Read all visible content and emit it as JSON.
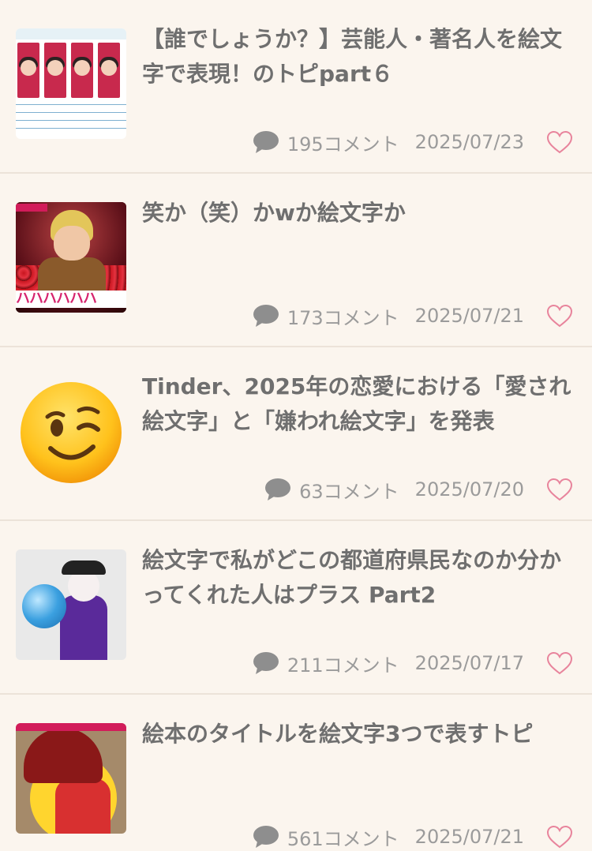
{
  "topics": [
    {
      "title": "【誰でしょうか？】芸能人・著名人を絵文字で表現！のトピpart６",
      "comments": "195コメント",
      "date": "2025/07/23",
      "thumb": "celebrity-table"
    },
    {
      "title": "笑か（笑）かwか絵文字か",
      "comments": "173コメント",
      "date": "2025/07/21",
      "thumb": "laughing-man",
      "thumb_text": "ハハハハハハ"
    },
    {
      "title": "Tinder、2025年の恋愛における「愛され絵文字」と「嫌われ絵文字」を発表",
      "comments": "63コメント",
      "date": "2025/07/20",
      "thumb": "winking-face-emoji"
    },
    {
      "title": "絵文字で私がどこの都道府県民なのか分かってくれた人はプラス Part2",
      "comments": "211コメント",
      "date": "2025/07/17",
      "thumb": "costume-globe"
    },
    {
      "title": "絵本のタイトルを絵文字3つで表すトピ",
      "comments": "561コメント",
      "date": "2025/07/21",
      "thumb": "kimono-woman"
    }
  ],
  "colors": {
    "background": "#fbf5ee",
    "title_text": "#6f6f6f",
    "meta_text": "#9b9b9b",
    "heart": "#e8849c",
    "divider": "#ece3d9"
  },
  "icons": {
    "comment": "comment-bubble-icon",
    "like": "heart-outline-icon"
  }
}
